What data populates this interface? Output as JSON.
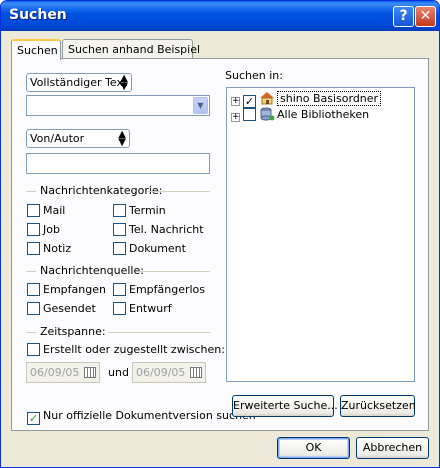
{
  "window": {
    "title": "Suchen"
  },
  "tabs": [
    {
      "label": "Suchen",
      "active": true
    },
    {
      "label": "Suchen anhand Beispiel",
      "active": false
    }
  ],
  "search": {
    "field_select": "Vollständiger Text",
    "text_value": "",
    "author_select": "Von/Autor",
    "author_value": ""
  },
  "category": {
    "label": "Nachrichtenkategorie:",
    "items": [
      {
        "label": "Mail",
        "checked": false
      },
      {
        "label": "Termin",
        "checked": false
      },
      {
        "label": "Job",
        "checked": false
      },
      {
        "label": "Tel. Nachricht",
        "checked": false
      },
      {
        "label": "Notiz",
        "checked": false
      },
      {
        "label": "Dokument",
        "checked": false
      }
    ]
  },
  "source": {
    "label": "Nachrichtenquelle:",
    "items": [
      {
        "label": "Empfangen",
        "checked": false
      },
      {
        "label": "Empfängerlos",
        "checked": false
      },
      {
        "label": "Gesendet",
        "checked": false
      },
      {
        "label": "Entwurf",
        "checked": false
      }
    ]
  },
  "timespan": {
    "label": "Zeitspanne:",
    "created_label": "Erstellt oder zugestellt zwischen:",
    "created_checked": false,
    "from_date": "06/09/05",
    "and_label": "und",
    "to_date": "06/09/05"
  },
  "official_only": {
    "label": "Nur offizielle Dokumentversion suchen",
    "checked": true
  },
  "search_in": {
    "label": "Suchen in:",
    "nodes": [
      {
        "label": "shino Basisordner",
        "checked": true,
        "icon": "home-folder-icon",
        "selected": true
      },
      {
        "label": "Alle Bibliotheken",
        "checked": false,
        "icon": "libraries-icon",
        "selected": false
      }
    ]
  },
  "buttons": {
    "advanced": "Erweiterte Suche...",
    "reset": "Zurücksetzen",
    "ok": "OK",
    "cancel": "Abbrechen"
  },
  "titlebar_buttons": {
    "help": "?",
    "close": "✕"
  }
}
